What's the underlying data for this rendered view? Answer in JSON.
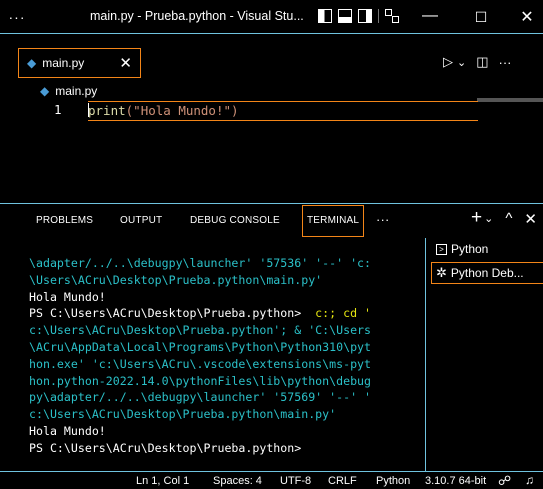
{
  "titlebar": {
    "menu_label": "···",
    "title": "main.py - Prueba.python - Visual Stu...",
    "minimize": "—",
    "maximize": "☐",
    "close": "✕"
  },
  "editor_tab": {
    "label": "main.py",
    "close": "✕"
  },
  "tab_actions": {
    "run": "▷",
    "run_menu": "⌄",
    "split": "◫",
    "more": "···"
  },
  "breadcrumb": {
    "file": "main.py"
  },
  "editor": {
    "line_number": "1",
    "code_fn": "print",
    "code_arg": "(\"Hola Mundo!\")"
  },
  "panel": {
    "tabs": [
      "PROBLEMS",
      "OUTPUT",
      "DEBUG CONSOLE",
      "TERMINAL"
    ],
    "tabs_more": "···",
    "actions": {
      "new": "+",
      "new_menu": "⌄",
      "maximize": "^",
      "close": "✕"
    }
  },
  "terminal": {
    "l1": "\\adapter/../..\\debugpy\\launcher' '57536' '--' 'c:",
    "l2": "\\Users\\ACru\\Desktop\\Prueba.python\\main.py'",
    "l3": "Hola Mundo!",
    "l4_prompt": "PS C:\\Users\\ACru\\Desktop\\Prueba.python> ",
    "l4_cmd": " c:; cd '",
    "l5": "c:\\Users\\ACru\\Desktop\\Prueba.python'; & 'C:\\Users",
    "l6": "\\ACru\\AppData\\Local\\Programs\\Python\\Python310\\pyt",
    "l7": "hon.exe' 'c:\\Users\\ACru\\.vscode\\extensions\\ms-pyt",
    "l8": "hon.python-2022.14.0\\pythonFiles\\lib\\python\\debug",
    "l9": "py\\adapter/../..\\debugpy\\launcher' '57569' '--' '",
    "l10": "c:\\Users\\ACru\\Desktop\\Prueba.python\\main.py'",
    "l11": "Hola Mundo!",
    "l12": "PS C:\\Users\\ACru\\Desktop\\Prueba.python>"
  },
  "terminal_list": [
    {
      "label": "Python",
      "icon": "terminal-icon"
    },
    {
      "label": "Python Deb...",
      "icon": "debug-icon"
    }
  ],
  "statusbar": {
    "position": "Ln 1, Col 1",
    "spaces": "Spaces: 4",
    "encoding": "UTF-8",
    "eol": "CRLF",
    "language": "Python",
    "interpreter": "3.10.7 64-bit"
  },
  "colors": {
    "border": "#6fc3df",
    "focus": "#f38518",
    "string": "#ce9178",
    "function": "#dcdcaa"
  }
}
